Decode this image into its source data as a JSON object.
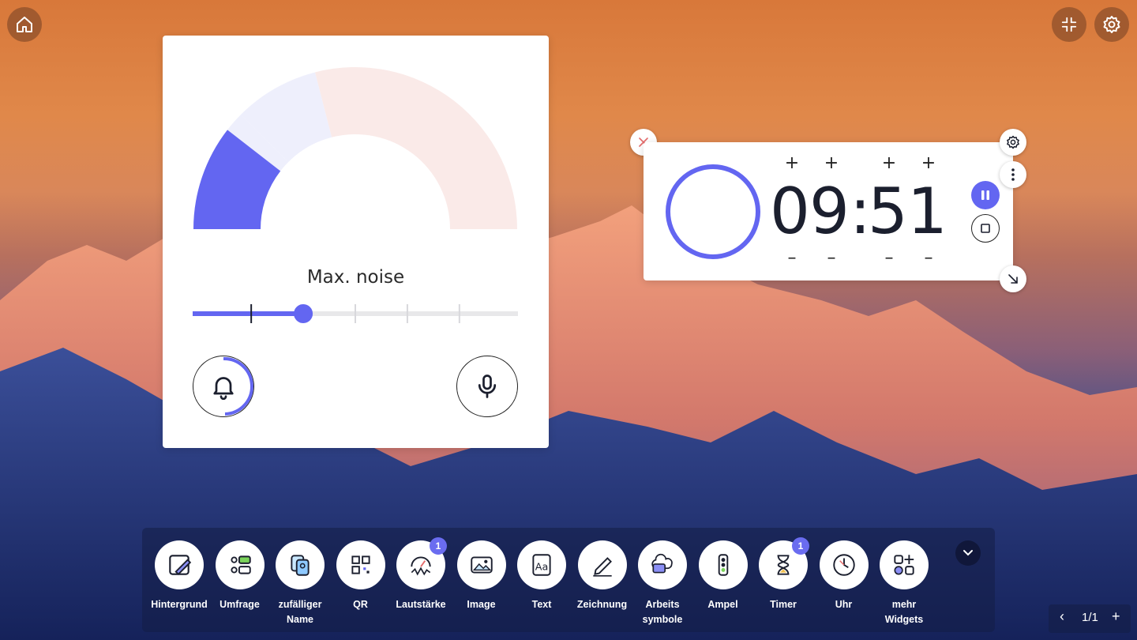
{
  "noise_meter": {
    "title": "Max. noise",
    "max_level_fraction": 0.34,
    "current_level_fraction": 0.2,
    "colors": {
      "active": "#6366f1",
      "zone_mid": "#eeeffc",
      "zone_high": "#faeae8"
    }
  },
  "timer": {
    "minutes_tens": "0",
    "minutes_ones": "9",
    "separator": ":",
    "seconds_tens": "5",
    "seconds_ones": "1",
    "increment_symbol": "+",
    "decrement_symbol": "–",
    "accent_color": "#6366f1"
  },
  "toolbar": {
    "items": [
      {
        "label": "Hintergrund",
        "icon": "background-edit-icon"
      },
      {
        "label": "Umfrage",
        "icon": "poll-icon"
      },
      {
        "label": "zufälliger Name",
        "icon": "random-name-icon"
      },
      {
        "label": "QR",
        "icon": "qr-code-icon"
      },
      {
        "label": "Lautstärke",
        "icon": "noise-meter-icon",
        "badge": "1"
      },
      {
        "label": "Image",
        "icon": "image-icon"
      },
      {
        "label": "Text",
        "icon": "text-icon"
      },
      {
        "label": "Zeichnung",
        "icon": "drawing-icon"
      },
      {
        "label": "Arbeits symbole",
        "icon": "work-symbols-icon"
      },
      {
        "label": "Ampel",
        "icon": "traffic-light-icon"
      },
      {
        "label": "Timer",
        "icon": "hourglass-icon",
        "badge": "1"
      },
      {
        "label": "Uhr",
        "icon": "clock-icon"
      },
      {
        "label": "mehr Widgets",
        "icon": "more-widgets-icon"
      }
    ]
  },
  "pager": {
    "prev": "‹",
    "current": "1/1",
    "add": "+"
  }
}
